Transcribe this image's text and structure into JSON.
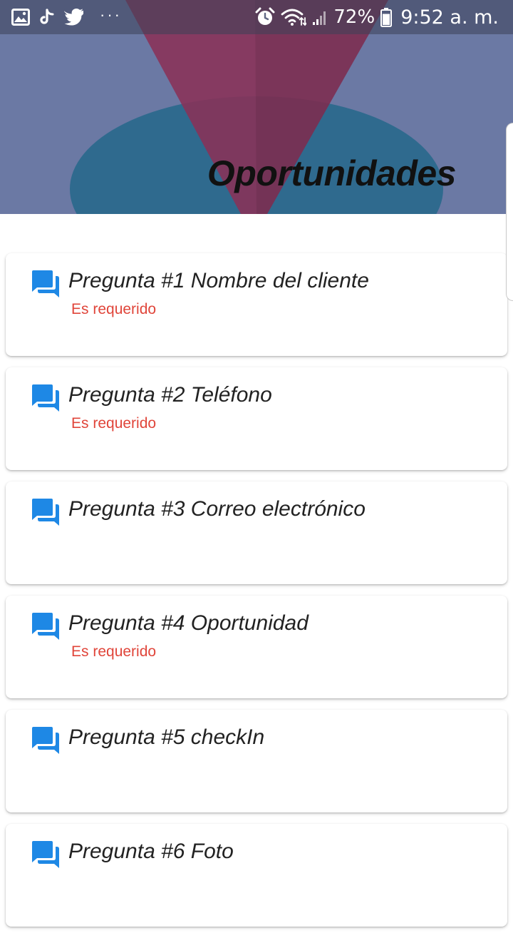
{
  "status_bar": {
    "left_icons": [
      "gallery-icon",
      "tiktok-icon",
      "twitter-icon"
    ],
    "more_indicator": "···",
    "right_icons": [
      "alarm-icon",
      "wifi-icon",
      "signal-icon",
      "battery-icon"
    ],
    "battery": "72%",
    "time": "9:52 a. m."
  },
  "header": {
    "title": "Oportunidades",
    "colors": {
      "background": "#6b79a4",
      "blob": "#2f6a8e",
      "cone": "#8a3158"
    }
  },
  "questions": [
    {
      "label": "Pregunta #1 Nombre del cliente",
      "required_text": "Es requerido"
    },
    {
      "label": "Pregunta #2 Teléfono",
      "required_text": "Es requerido"
    },
    {
      "label": "Pregunta #3 Correo electrónico",
      "required_text": ""
    },
    {
      "label": "Pregunta #4 Oportunidad",
      "required_text": "Es requerido"
    },
    {
      "label": "Pregunta #5 checkIn",
      "required_text": ""
    },
    {
      "label": "Pregunta #6 Foto",
      "required_text": ""
    }
  ],
  "colors": {
    "icon_blue": "#1e88e5",
    "required_red": "#e0453a"
  }
}
